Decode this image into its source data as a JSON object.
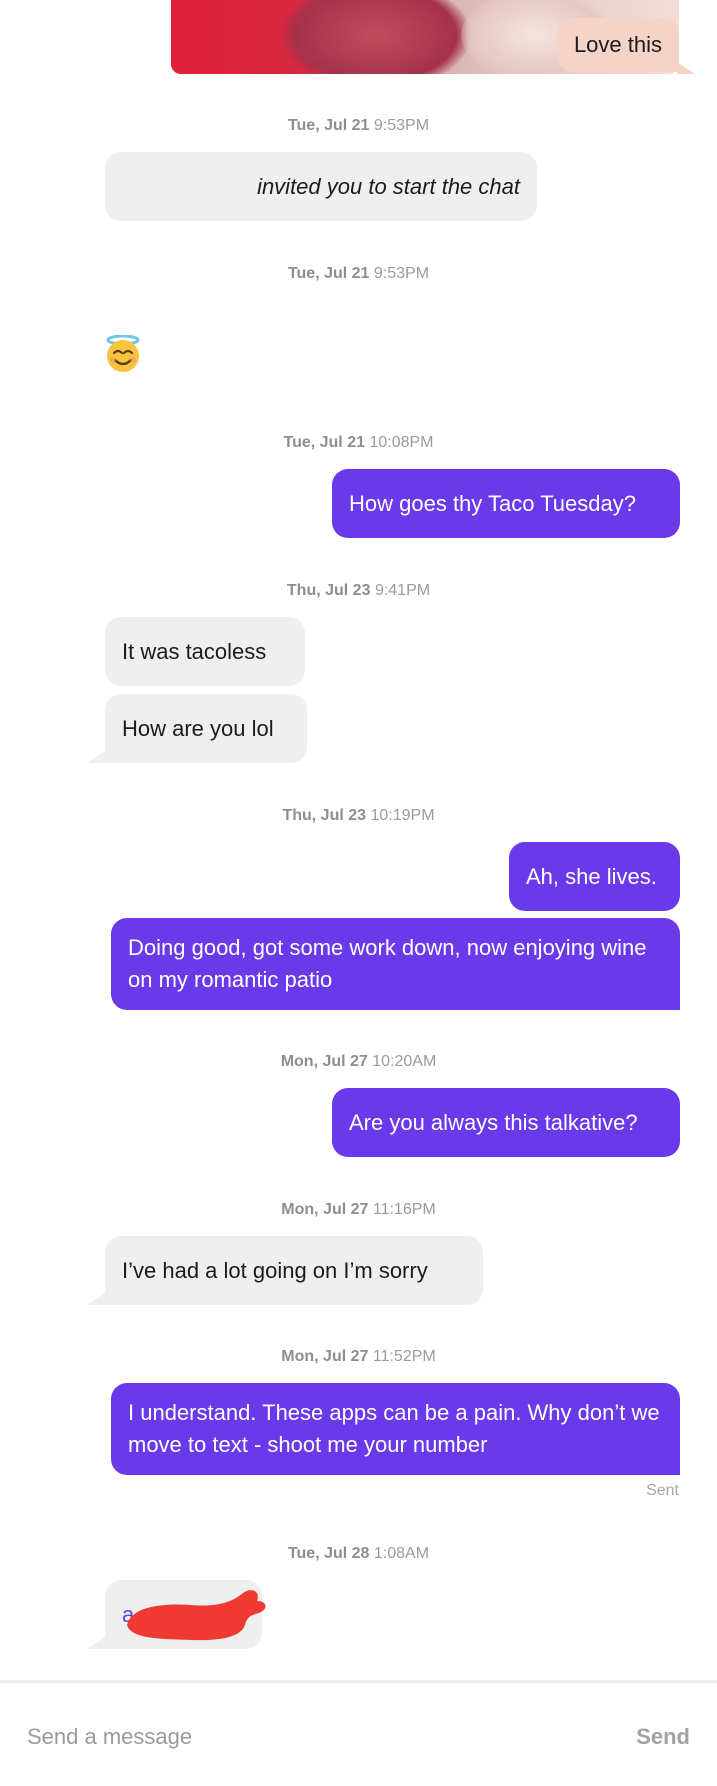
{
  "thread": {
    "photo_caption": "Love this",
    "timestamps": [
      {
        "day": "Tue, Jul 21",
        "time": "9:53PM"
      },
      {
        "day": "Tue, Jul 21",
        "time": "9:53PM"
      },
      {
        "day": "Tue, Jul 21",
        "time": "10:08PM"
      },
      {
        "day": "Thu, Jul 23",
        "time": "9:41PM"
      },
      {
        "day": "Thu, Jul 23",
        "time": "10:19PM"
      },
      {
        "day": "Mon, Jul 27",
        "time": "10:20AM"
      },
      {
        "day": "Mon, Jul 27",
        "time": "11:16PM"
      },
      {
        "day": "Mon, Jul 27",
        "time": "11:52PM"
      },
      {
        "day": "Tue, Jul 28",
        "time": "1:08AM"
      }
    ],
    "system_message": "invited you to start the chat",
    "emoji_message": "smiling-face-with-halo",
    "messages": [
      {
        "text": "How goes thy Taco Tuesday?"
      },
      {
        "text": "It was tacoless"
      },
      {
        "text": "How are you lol"
      },
      {
        "text": "Ah, she lives."
      },
      {
        "text": "Doing good, got some work down, now enjoying wine on my romantic patio"
      },
      {
        "text": "Are you always this talkative?"
      },
      {
        "text": "I’ve had a lot going on I’m sorry"
      },
      {
        "text": "I understand. These apps can be a pain. Why don’t we move to text - shoot me your number"
      },
      {
        "text": "a"
      }
    ],
    "delivery_status": "Sent"
  },
  "composer": {
    "placeholder": "Send a message",
    "send_label": "Send"
  },
  "colors": {
    "outgoing": "#6a39ea",
    "incoming": "#efefef",
    "photo_caption": "#f6d3c9",
    "redaction": "#ef3a34"
  }
}
